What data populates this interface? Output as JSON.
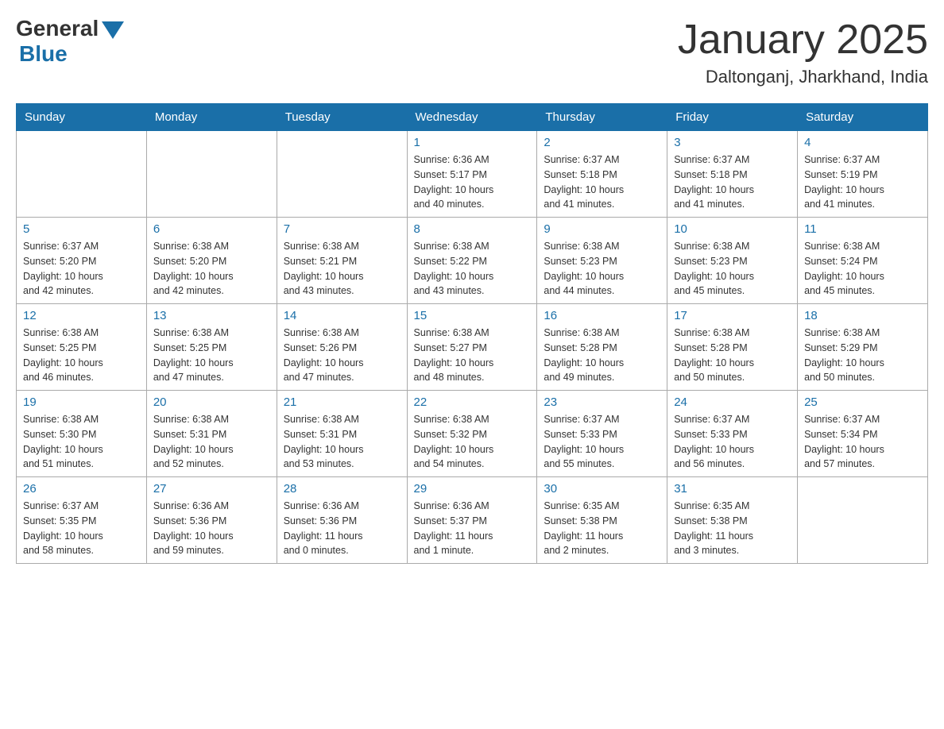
{
  "header": {
    "logo_general": "General",
    "logo_blue": "Blue",
    "month_title": "January 2025",
    "location": "Daltonganj, Jharkhand, India"
  },
  "weekdays": [
    "Sunday",
    "Monday",
    "Tuesday",
    "Wednesday",
    "Thursday",
    "Friday",
    "Saturday"
  ],
  "weeks": [
    [
      {
        "day": "",
        "info": ""
      },
      {
        "day": "",
        "info": ""
      },
      {
        "day": "",
        "info": ""
      },
      {
        "day": "1",
        "info": "Sunrise: 6:36 AM\nSunset: 5:17 PM\nDaylight: 10 hours\nand 40 minutes."
      },
      {
        "day": "2",
        "info": "Sunrise: 6:37 AM\nSunset: 5:18 PM\nDaylight: 10 hours\nand 41 minutes."
      },
      {
        "day": "3",
        "info": "Sunrise: 6:37 AM\nSunset: 5:18 PM\nDaylight: 10 hours\nand 41 minutes."
      },
      {
        "day": "4",
        "info": "Sunrise: 6:37 AM\nSunset: 5:19 PM\nDaylight: 10 hours\nand 41 minutes."
      }
    ],
    [
      {
        "day": "5",
        "info": "Sunrise: 6:37 AM\nSunset: 5:20 PM\nDaylight: 10 hours\nand 42 minutes."
      },
      {
        "day": "6",
        "info": "Sunrise: 6:38 AM\nSunset: 5:20 PM\nDaylight: 10 hours\nand 42 minutes."
      },
      {
        "day": "7",
        "info": "Sunrise: 6:38 AM\nSunset: 5:21 PM\nDaylight: 10 hours\nand 43 minutes."
      },
      {
        "day": "8",
        "info": "Sunrise: 6:38 AM\nSunset: 5:22 PM\nDaylight: 10 hours\nand 43 minutes."
      },
      {
        "day": "9",
        "info": "Sunrise: 6:38 AM\nSunset: 5:23 PM\nDaylight: 10 hours\nand 44 minutes."
      },
      {
        "day": "10",
        "info": "Sunrise: 6:38 AM\nSunset: 5:23 PM\nDaylight: 10 hours\nand 45 minutes."
      },
      {
        "day": "11",
        "info": "Sunrise: 6:38 AM\nSunset: 5:24 PM\nDaylight: 10 hours\nand 45 minutes."
      }
    ],
    [
      {
        "day": "12",
        "info": "Sunrise: 6:38 AM\nSunset: 5:25 PM\nDaylight: 10 hours\nand 46 minutes."
      },
      {
        "day": "13",
        "info": "Sunrise: 6:38 AM\nSunset: 5:25 PM\nDaylight: 10 hours\nand 47 minutes."
      },
      {
        "day": "14",
        "info": "Sunrise: 6:38 AM\nSunset: 5:26 PM\nDaylight: 10 hours\nand 47 minutes."
      },
      {
        "day": "15",
        "info": "Sunrise: 6:38 AM\nSunset: 5:27 PM\nDaylight: 10 hours\nand 48 minutes."
      },
      {
        "day": "16",
        "info": "Sunrise: 6:38 AM\nSunset: 5:28 PM\nDaylight: 10 hours\nand 49 minutes."
      },
      {
        "day": "17",
        "info": "Sunrise: 6:38 AM\nSunset: 5:28 PM\nDaylight: 10 hours\nand 50 minutes."
      },
      {
        "day": "18",
        "info": "Sunrise: 6:38 AM\nSunset: 5:29 PM\nDaylight: 10 hours\nand 50 minutes."
      }
    ],
    [
      {
        "day": "19",
        "info": "Sunrise: 6:38 AM\nSunset: 5:30 PM\nDaylight: 10 hours\nand 51 minutes."
      },
      {
        "day": "20",
        "info": "Sunrise: 6:38 AM\nSunset: 5:31 PM\nDaylight: 10 hours\nand 52 minutes."
      },
      {
        "day": "21",
        "info": "Sunrise: 6:38 AM\nSunset: 5:31 PM\nDaylight: 10 hours\nand 53 minutes."
      },
      {
        "day": "22",
        "info": "Sunrise: 6:38 AM\nSunset: 5:32 PM\nDaylight: 10 hours\nand 54 minutes."
      },
      {
        "day": "23",
        "info": "Sunrise: 6:37 AM\nSunset: 5:33 PM\nDaylight: 10 hours\nand 55 minutes."
      },
      {
        "day": "24",
        "info": "Sunrise: 6:37 AM\nSunset: 5:33 PM\nDaylight: 10 hours\nand 56 minutes."
      },
      {
        "day": "25",
        "info": "Sunrise: 6:37 AM\nSunset: 5:34 PM\nDaylight: 10 hours\nand 57 minutes."
      }
    ],
    [
      {
        "day": "26",
        "info": "Sunrise: 6:37 AM\nSunset: 5:35 PM\nDaylight: 10 hours\nand 58 minutes."
      },
      {
        "day": "27",
        "info": "Sunrise: 6:36 AM\nSunset: 5:36 PM\nDaylight: 10 hours\nand 59 minutes."
      },
      {
        "day": "28",
        "info": "Sunrise: 6:36 AM\nSunset: 5:36 PM\nDaylight: 11 hours\nand 0 minutes."
      },
      {
        "day": "29",
        "info": "Sunrise: 6:36 AM\nSunset: 5:37 PM\nDaylight: 11 hours\nand 1 minute."
      },
      {
        "day": "30",
        "info": "Sunrise: 6:35 AM\nSunset: 5:38 PM\nDaylight: 11 hours\nand 2 minutes."
      },
      {
        "day": "31",
        "info": "Sunrise: 6:35 AM\nSunset: 5:38 PM\nDaylight: 11 hours\nand 3 minutes."
      },
      {
        "day": "",
        "info": ""
      }
    ]
  ]
}
